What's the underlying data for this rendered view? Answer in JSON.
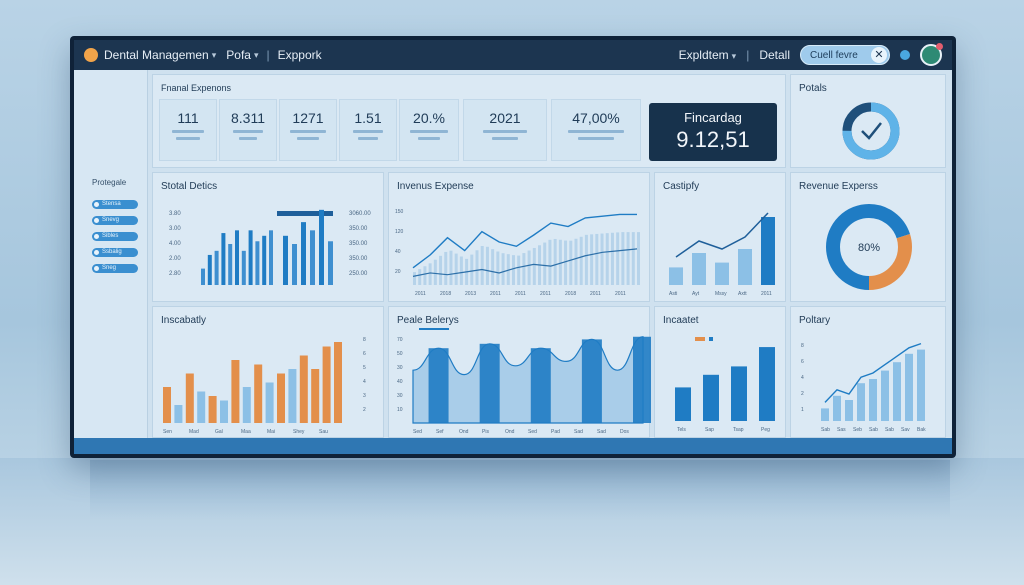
{
  "header": {
    "app_title": "Dental Managemen",
    "menu_1": "Pofa",
    "menu_2": "Exppork",
    "right_menu_1": "Expldtem",
    "right_menu_2": "Detall",
    "search_placeholder": "Cuell fevre"
  },
  "sidebar": {
    "title": "Protegale",
    "items": [
      "Stensa",
      "Snevg",
      "Sibles",
      "Ssbalig",
      "Sneg"
    ]
  },
  "finance": {
    "title": "Fnanal Expenons",
    "kpis": [
      {
        "value": "111"
      },
      {
        "value": "8.311"
      },
      {
        "value": "1271"
      },
      {
        "value": "1.51"
      },
      {
        "value": "20.%"
      },
      {
        "value": "2021"
      },
      {
        "value": "47,00%"
      }
    ],
    "highlight_label": "Fincardag",
    "highlight_value": "9.12,51"
  },
  "potals": {
    "title": "Potals",
    "progress": 0.75
  },
  "colors": {
    "primary": "#1f7cc4",
    "light": "#8cc0e6",
    "orange": "#e38f4b",
    "dark": "#17324c"
  },
  "chart_data": [
    {
      "type": "bar",
      "title": "Stotal Detics",
      "y_ticks_left": [
        "3.80",
        "3.00",
        "4.00",
        "2.00",
        "2.80"
      ],
      "y_ticks_right": [
        "3060.00",
        "350.00",
        "350.00",
        "350.00",
        "250.00"
      ],
      "series": [
        {
          "values": [
            12,
            22,
            25,
            38,
            30,
            40,
            25,
            40,
            32,
            36,
            40
          ]
        },
        {
          "values": [
            36,
            30,
            46,
            40,
            55,
            32
          ]
        }
      ]
    },
    {
      "type": "area",
      "title": "Invenus Expense",
      "x_ticks": [
        "2011",
        "2018",
        "2013",
        "2011",
        "2011",
        "2011",
        "2018",
        "2011",
        "2011"
      ],
      "series": [
        {
          "values": [
            20,
            35,
            55,
            40,
            62,
            50,
            45,
            58,
            72,
            68,
            78,
            80,
            82,
            82
          ]
        },
        {
          "values": [
            10,
            14,
            12,
            15,
            18,
            14,
            20,
            24,
            22,
            28,
            34,
            38,
            40,
            42
          ]
        }
      ]
    },
    {
      "type": "bar",
      "title": "Castipfy",
      "x_ticks": [
        "Asti",
        "Ayt",
        "Mssy",
        "Axtt",
        "2011"
      ],
      "values": [
        22,
        40,
        28,
        45,
        85
      ],
      "line": [
        35,
        55,
        45,
        60,
        90
      ]
    },
    {
      "type": "pie",
      "title": "Revenue Experss",
      "center_label": "80%",
      "values": [
        70,
        30
      ]
    },
    {
      "type": "bar",
      "title": "Inscabatly",
      "x_ticks": [
        "Sen",
        "Mad",
        "Gal",
        "Maa",
        "Mai",
        "Shey",
        "Sau"
      ],
      "series": [
        {
          "values": [
            40,
            55,
            30,
            70,
            65,
            55,
            75,
            60,
            85,
            90
          ]
        },
        {
          "values": [
            20,
            35,
            25,
            40,
            45,
            60
          ]
        }
      ]
    },
    {
      "type": "area",
      "title": "Peale Belerys",
      "x_ticks": [
        "Sed",
        "Sef",
        "Ond",
        "Pis",
        "Ond",
        "Sed",
        "Pad",
        "Sad",
        "Sad",
        "Dos"
      ],
      "values": [
        60,
        85,
        55,
        90,
        65,
        85,
        70,
        95,
        60,
        98
      ]
    },
    {
      "type": "bar",
      "title": "Incaatet",
      "x_ticks": [
        "Tels",
        "Sap",
        "Tsap",
        "Peg"
      ],
      "values": [
        40,
        55,
        65,
        88
      ]
    },
    {
      "type": "bar",
      "title": "Poltary",
      "x_ticks": [
        "Sab",
        "Sas",
        "Seb",
        "Sab",
        "Sab",
        "Sav",
        "Bak"
      ],
      "values": [
        15,
        30,
        25,
        45,
        50,
        60,
        70,
        80,
        85
      ]
    }
  ]
}
